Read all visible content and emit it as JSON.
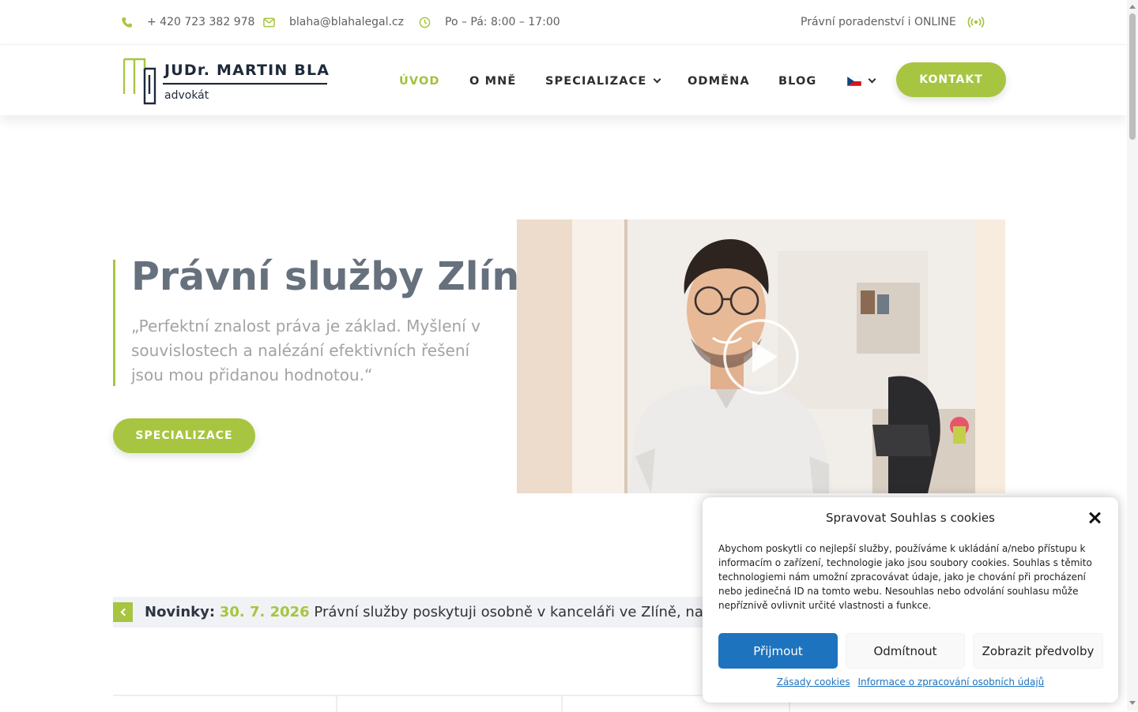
{
  "topbar": {
    "phone": "+ 420 723 382 978",
    "email": "blaha@blahalegal.cz",
    "hours": "Po – Pá: 8:00 – 17:00",
    "online": "Právní poradenství i ONLINE",
    "icons": [
      "phone-icon",
      "envelope-icon",
      "clock-icon",
      "broadcast-icon"
    ],
    "icon_color": "#a7c540"
  },
  "header": {
    "logo": {
      "name": "JUDr. MARTIN BLAHA",
      "subtitle": "advokát"
    },
    "nav": [
      {
        "label": "ÚVOD",
        "active": true
      },
      {
        "label": "O MNĚ"
      },
      {
        "label": "SPECIALIZACE",
        "dropdown": true
      },
      {
        "label": "ODMĚNA"
      },
      {
        "label": "BLOG"
      }
    ],
    "language": "CZ flag",
    "contact_button": "KONTAKT"
  },
  "hero": {
    "title": "Právní služby Zlín",
    "quote": "„Perfektní znalost práva je základ. Myšlení v souvislostech a nalézání efektivních řešení jsou mou přidanou hodnotou.“",
    "button": "SPECIALIZACE"
  },
  "news": {
    "label": "Novinky:",
    "date": "30. 7. 2026",
    "text": "Právní služby poskytuji osobně v kanceláři ve Zlíně, na pobočce"
  },
  "cookie": {
    "title": "Spravovat Souhlas s cookies",
    "body": "Abychom poskytli co nejlepší služby, používáme k ukládání a/nebo přístupu k informacím o zařízení, technologie jako jsou soubory cookies. Souhlas s těmito technologiemi nám umožní zpracovávat údaje, jako je chování při procházení nebo jedinečná ID na tomto webu. Nesouhlas nebo odvolání souhlasu může nepříznivě ovlivnit určité vlastnosti a funkce.",
    "accept": "Přijmout",
    "deny": "Odmítnout",
    "preferences": "Zobrazit předvolby",
    "link_policy": "Zásady cookies",
    "link_privacy": "Informace o zpracování osobních údajů"
  },
  "colors": {
    "accent": "#a7c540",
    "cookie_primary": "#1e73be",
    "title_gray": "#66717d"
  }
}
